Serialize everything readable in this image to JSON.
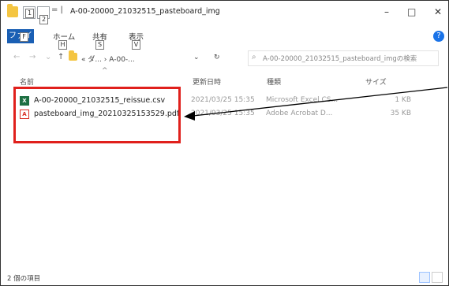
{
  "window": {
    "title": "A-00-20000_21032515_pasteboard_img",
    "title_separator": "= |",
    "minimize_symbol": "–",
    "maximize_symbol": "□",
    "close_symbol": "✕"
  },
  "quick_access_keytips": [
    "1",
    "2"
  ],
  "ribbon": {
    "tabs": [
      {
        "label": "ファイル",
        "keytip": ""
      },
      {
        "label": "ホーム",
        "keytip": "H"
      },
      {
        "label": "共有",
        "keytip": "S"
      },
      {
        "label": "表示",
        "keytip": "V"
      }
    ],
    "file_tab_label": "ファイル"
  },
  "address_bar": {
    "up_symbol": "↑",
    "breadcrumb": "« ダ... › A-00-...",
    "dropdown_symbol": "⌄",
    "refresh_symbol": "↻"
  },
  "search": {
    "placeholder": "A-00-20000_21032515_pasteboard_imgの検索"
  },
  "columns": {
    "name": "名前",
    "date": "更新日時",
    "type": "種類",
    "size": "サイズ"
  },
  "files": [
    {
      "name": "A-00-20000_21032515_reissue.csv",
      "date": "2021/03/25 15:35",
      "type": "Microsoft Excel CS...",
      "size": "1 KB",
      "icon": "excel-csv-icon",
      "icon_glyph": "X"
    },
    {
      "name": "pasteboard_img_20210325153529.pdf",
      "date": "2021/03/25 15:35",
      "type": "Adobe Acrobat D...",
      "size": "35 KB",
      "icon": "pdf-icon",
      "icon_glyph": "A"
    }
  ],
  "status_bar": {
    "item_count": "2 個の項目"
  },
  "colors": {
    "file_tab": "#1a5fb4",
    "highlight_border": "#e0201c",
    "arrow": "#000000"
  }
}
